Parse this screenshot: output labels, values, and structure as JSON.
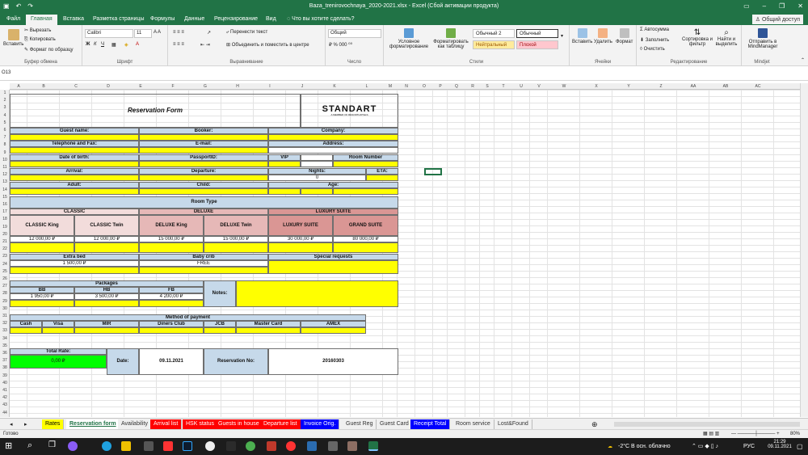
{
  "window": {
    "title": "Baza_trenirovochnaya_2020-2021.xlsx - Excel (Сбой активации продукта)",
    "share": "Общий доступ"
  },
  "tabs": [
    "Файл",
    "Главная",
    "Вставка",
    "Разметка страницы",
    "Формулы",
    "Данные",
    "Рецензирование",
    "Вид",
    "Что вы хотите сделать?"
  ],
  "ribbon": {
    "paste": "Вставить",
    "cut": "Вырезать",
    "copy": "Копировать",
    "format_painter": "Формат по образцу",
    "clipboard": "Буфер обмена",
    "font_name": "Calibri",
    "font_size": "11",
    "font_group": "Шрифт",
    "wrap": "Перенести текст",
    "merge": "Объединить и поместить в центре",
    "align_group": "Выравнивание",
    "number_format": "Общий",
    "number_group": "Число",
    "cond_format": "Условное форматирование",
    "format_table": "Форматировать как таблицу",
    "style_normal2": "Обычный 2",
    "style_normal": "Обычный",
    "style_neutral": "Нейтральный",
    "style_bad": "Плохой",
    "styles_group": "Стили",
    "insert": "Вставить",
    "delete": "Удалить",
    "format": "Формат",
    "cells_group": "Ячейки",
    "autosum": "Автосумма",
    "fill": "Заполнить",
    "clear": "Очистить",
    "sort": "Сортировка и фильтр",
    "find": "Найти и выделить",
    "edit_group": "Редактирование",
    "mind": "Отправить в MindManager",
    "mind_group": "Mindjet"
  },
  "namebox": "O13",
  "columns": [
    "A",
    "B",
    "C",
    "D",
    "E",
    "F",
    "G",
    "H",
    "I",
    "J",
    "K",
    "L",
    "M",
    "N",
    "O",
    "P",
    "Q",
    "R",
    "S",
    "T",
    "U",
    "V",
    "W",
    "X",
    "Y",
    "Z",
    "AA",
    "AB",
    "AC"
  ],
  "rows": [
    "1",
    "2",
    "3",
    "4",
    "5",
    "6",
    "7",
    "8",
    "9",
    "10",
    "11",
    "12",
    "13",
    "14",
    "15",
    "16",
    "17",
    "18",
    "19",
    "20",
    "21",
    "22",
    "23",
    "24",
    "25",
    "26",
    "27",
    "28",
    "29",
    "30",
    "31",
    "32",
    "33",
    "34",
    "35",
    "36",
    "37",
    "38",
    "39",
    "40",
    "41",
    "42",
    "43",
    "44"
  ],
  "form": {
    "title": "Reservation Form",
    "logo": "STANDART",
    "logo_sub": "A MEMBER OF RESORTHOTELS",
    "guest": "Guest name:",
    "booker": "Booker:",
    "company": "Company:",
    "phone": "Telephone and Fax:",
    "email": "E-mail:",
    "address": "Address:",
    "dob": "Date of birth:",
    "passport": "PassportID:",
    "vip": "VIP",
    "room_number": "Room Number",
    "arrival": "Arrival:",
    "departure": "Departure:",
    "nights": "Nights:",
    "eta": "ETA:",
    "nights_val": "0",
    "adult": "Adult:",
    "child": "Child:",
    "age": "Age:",
    "room_type": "Room Type",
    "classic": "CLASSIC",
    "deluxe": "DELUXE",
    "luxury": "LUXURY SUITE",
    "rooms": [
      "CLASSIC King",
      "CLASSIC Twin",
      "DELUXE King",
      "DELUXE Twin",
      "LUXURY SUITE",
      "GRAND SUITE"
    ],
    "prices": [
      "12 000,00 ₽",
      "12 000,00 ₽",
      "15 000,00 ₽",
      "15 000,00 ₽",
      "30 000,00 ₽",
      "80 000,00 ₽"
    ],
    "extra_bed": "Extra bed",
    "extra_bed_price": "1 500,00 ₽",
    "baby_crib": "Baby crib",
    "baby_crib_val": "FREE",
    "special": "Special requests",
    "packages": "Packages",
    "bb": "BB",
    "hb": "HB",
    "fb": "FB",
    "bb_price": "1 950,00 ₽",
    "hb_price": "3 500,00 ₽",
    "fb_price": "4 200,00 ₽",
    "notes": "Notes:",
    "payment": "Method of payment",
    "pay": [
      "Cash",
      "Visa",
      "MIR",
      "Diners Club",
      "JCB",
      "Master Card",
      "AMEX"
    ],
    "total": "Total Rate:",
    "total_val": "0,00 ₽",
    "date_lbl": "Date:",
    "date_val": "09.11.2021",
    "resno_lbl": "Reservation No:",
    "resno_val": "20160303"
  },
  "sheets": [
    {
      "name": "Rates",
      "color": "#ffff00",
      "text": "#000"
    },
    {
      "name": "Reservation form",
      "color": "#ffffff",
      "text": "#217346"
    },
    {
      "name": "Availability",
      "color": "#f0f0f0",
      "text": "#333"
    },
    {
      "name": "Arrival list",
      "color": "#ff0000",
      "text": "#fff"
    },
    {
      "name": "HSK status",
      "color": "#ff0000",
      "text": "#fff"
    },
    {
      "name": "Guests in house",
      "color": "#ff0000",
      "text": "#fff"
    },
    {
      "name": "Departure list",
      "color": "#ff0000",
      "text": "#fff"
    },
    {
      "name": "Invoice Orig.",
      "color": "#0000ff",
      "text": "#fff"
    },
    {
      "name": "Guest Reg",
      "color": "#f0f0f0",
      "text": "#333"
    },
    {
      "name": "Guest Card",
      "color": "#f0f0f0",
      "text": "#333"
    },
    {
      "name": "Receipt Total",
      "color": "#0000ff",
      "text": "#fff"
    },
    {
      "name": "Room service",
      "color": "#f0f0f0",
      "text": "#333"
    },
    {
      "name": "Lost&Found",
      "color": "#f0f0f0",
      "text": "#333"
    }
  ],
  "status": {
    "ready": "Готово",
    "zoom": "80%"
  },
  "taskbar": {
    "weather": "-2°C В осн. облачно",
    "lang": "РУС",
    "time": "21:29",
    "date": "09.11.2021"
  }
}
